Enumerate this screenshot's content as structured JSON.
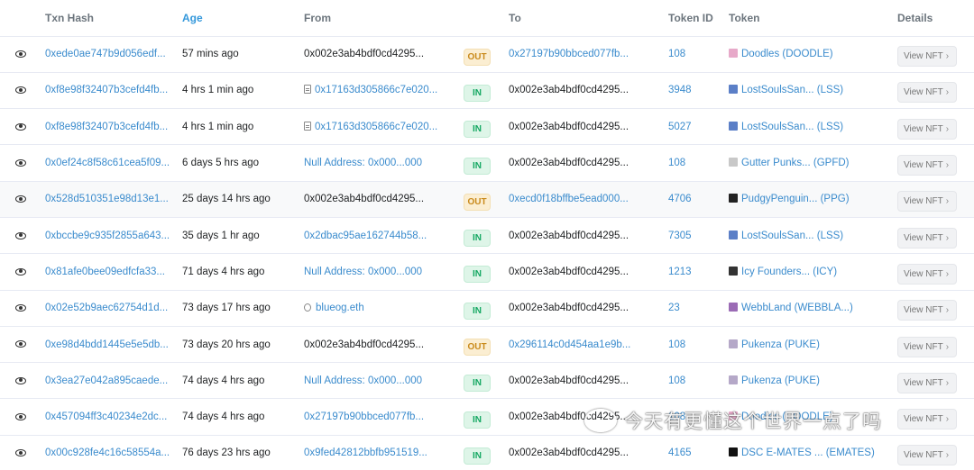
{
  "columns": {
    "txn_hash": "Txn Hash",
    "age": "Age",
    "from": "From",
    "to": "To",
    "token_id": "Token ID",
    "token": "Token",
    "details": "Details"
  },
  "view_nft_label": "View NFT",
  "watermark_text": "今天有更懂这个世界一点了吗",
  "colors": {
    "link": "#3a8bcd",
    "out_badge": "#fbeed2",
    "in_badge": "#def5e8",
    "active_header": "#3498db"
  },
  "rows": [
    {
      "hash": "0xede0ae747b9d056edf...",
      "age": "57 mins ago",
      "from": "0x002e3ab4bdf0cd4295...",
      "from_type": "plain",
      "dir": "OUT",
      "to": "0x27197b90bbced077fb...",
      "to_type": "link",
      "token_id": "108",
      "token": "Doodles (DOODLE)",
      "token_color": "#e7a9c9"
    },
    {
      "hash": "0xf8e98f32407b3cefd4fb...",
      "age": "4 hrs 1 min ago",
      "from": "0x17163d305866c7e020...",
      "from_type": "contract",
      "dir": "IN",
      "to": "0x002e3ab4bdf0cd4295...",
      "to_type": "plain",
      "token_id": "3948",
      "token": "LostSoulsSan... (LSS)",
      "token_color": "#5b7fc7"
    },
    {
      "hash": "0xf8e98f32407b3cefd4fb...",
      "age": "4 hrs 1 min ago",
      "from": "0x17163d305866c7e020...",
      "from_type": "contract",
      "dir": "IN",
      "to": "0x002e3ab4bdf0cd4295...",
      "to_type": "plain",
      "token_id": "5027",
      "token": "LostSoulsSan... (LSS)",
      "token_color": "#5b7fc7"
    },
    {
      "hash": "0x0ef24c8f58c61cea5f09...",
      "age": "6 days 5 hrs ago",
      "from": "Null Address: 0x000...000",
      "from_type": "link",
      "dir": "IN",
      "to": "0x002e3ab4bdf0cd4295...",
      "to_type": "plain",
      "token_id": "108",
      "token": "Gutter Punks... (GPFD)",
      "token_color": "#c8c8c8"
    },
    {
      "hash": "0x528d510351e98d13e1...",
      "age": "25 days 14 hrs ago",
      "from": "0x002e3ab4bdf0cd4295...",
      "from_type": "plain",
      "dir": "OUT",
      "to": "0xecd0f18bffbe5ead000...",
      "to_type": "link",
      "token_id": "4706",
      "token": "PudgyPenguin... (PPG)",
      "token_color": "#222222",
      "hl": true
    },
    {
      "hash": "0xbccbe9c935f2855a643...",
      "age": "35 days 1 hr ago",
      "from": "0x2dbac95ae162744b58...",
      "from_type": "link",
      "dir": "IN",
      "to": "0x002e3ab4bdf0cd4295...",
      "to_type": "plain",
      "token_id": "7305",
      "token": "LostSoulsSan... (LSS)",
      "token_color": "#5b7fc7"
    },
    {
      "hash": "0x81afe0bee09edfcfa33...",
      "age": "71 days 4 hrs ago",
      "from": "Null Address: 0x000...000",
      "from_type": "link",
      "dir": "IN",
      "to": "0x002e3ab4bdf0cd4295...",
      "to_type": "plain",
      "token_id": "1213",
      "token": "Icy Founders... (ICY)",
      "token_color": "#333333"
    },
    {
      "hash": "0x02e52b9aec62754d1d...",
      "age": "73 days 17 hrs ago",
      "from": "blueog.eth",
      "from_type": "ens",
      "dir": "IN",
      "to": "0x002e3ab4bdf0cd4295...",
      "to_type": "plain",
      "token_id": "23",
      "token": "WebbLand (WEBBLA...)",
      "token_color": "#9b6bb5"
    },
    {
      "hash": "0xe98d4bdd1445e5e5db...",
      "age": "73 days 20 hrs ago",
      "from": "0x002e3ab4bdf0cd4295...",
      "from_type": "plain",
      "dir": "OUT",
      "to": "0x296114c0d454aa1e9b...",
      "to_type": "link",
      "token_id": "108",
      "token": "Pukenza (PUKE)",
      "token_color": "#b5a8c8"
    },
    {
      "hash": "0x3ea27e042a895caede...",
      "age": "74 days 4 hrs ago",
      "from": "Null Address: 0x000...000",
      "from_type": "link",
      "dir": "IN",
      "to": "0x002e3ab4bdf0cd4295...",
      "to_type": "plain",
      "token_id": "108",
      "token": "Pukenza (PUKE)",
      "token_color": "#b5a8c8"
    },
    {
      "hash": "0x457094ff3c40234e2dc...",
      "age": "74 days 4 hrs ago",
      "from": "0x27197b90bbced077fb...",
      "from_type": "link",
      "dir": "IN",
      "to": "0x002e3ab4bdf0cd4295...",
      "to_type": "plain",
      "token_id": "108",
      "token": "Doodles (DOODLE)",
      "token_color": "#e7a9c9"
    },
    {
      "hash": "0x00c928fe4c16c58554a...",
      "age": "76 days 23 hrs ago",
      "from": "0x9fed42812bbfb951519...",
      "from_type": "link",
      "dir": "IN",
      "to": "0x002e3ab4bdf0cd4295...",
      "to_type": "plain",
      "token_id": "4165",
      "token": "DSC E-MATES ... (EMATES)",
      "token_color": "#111111"
    }
  ]
}
